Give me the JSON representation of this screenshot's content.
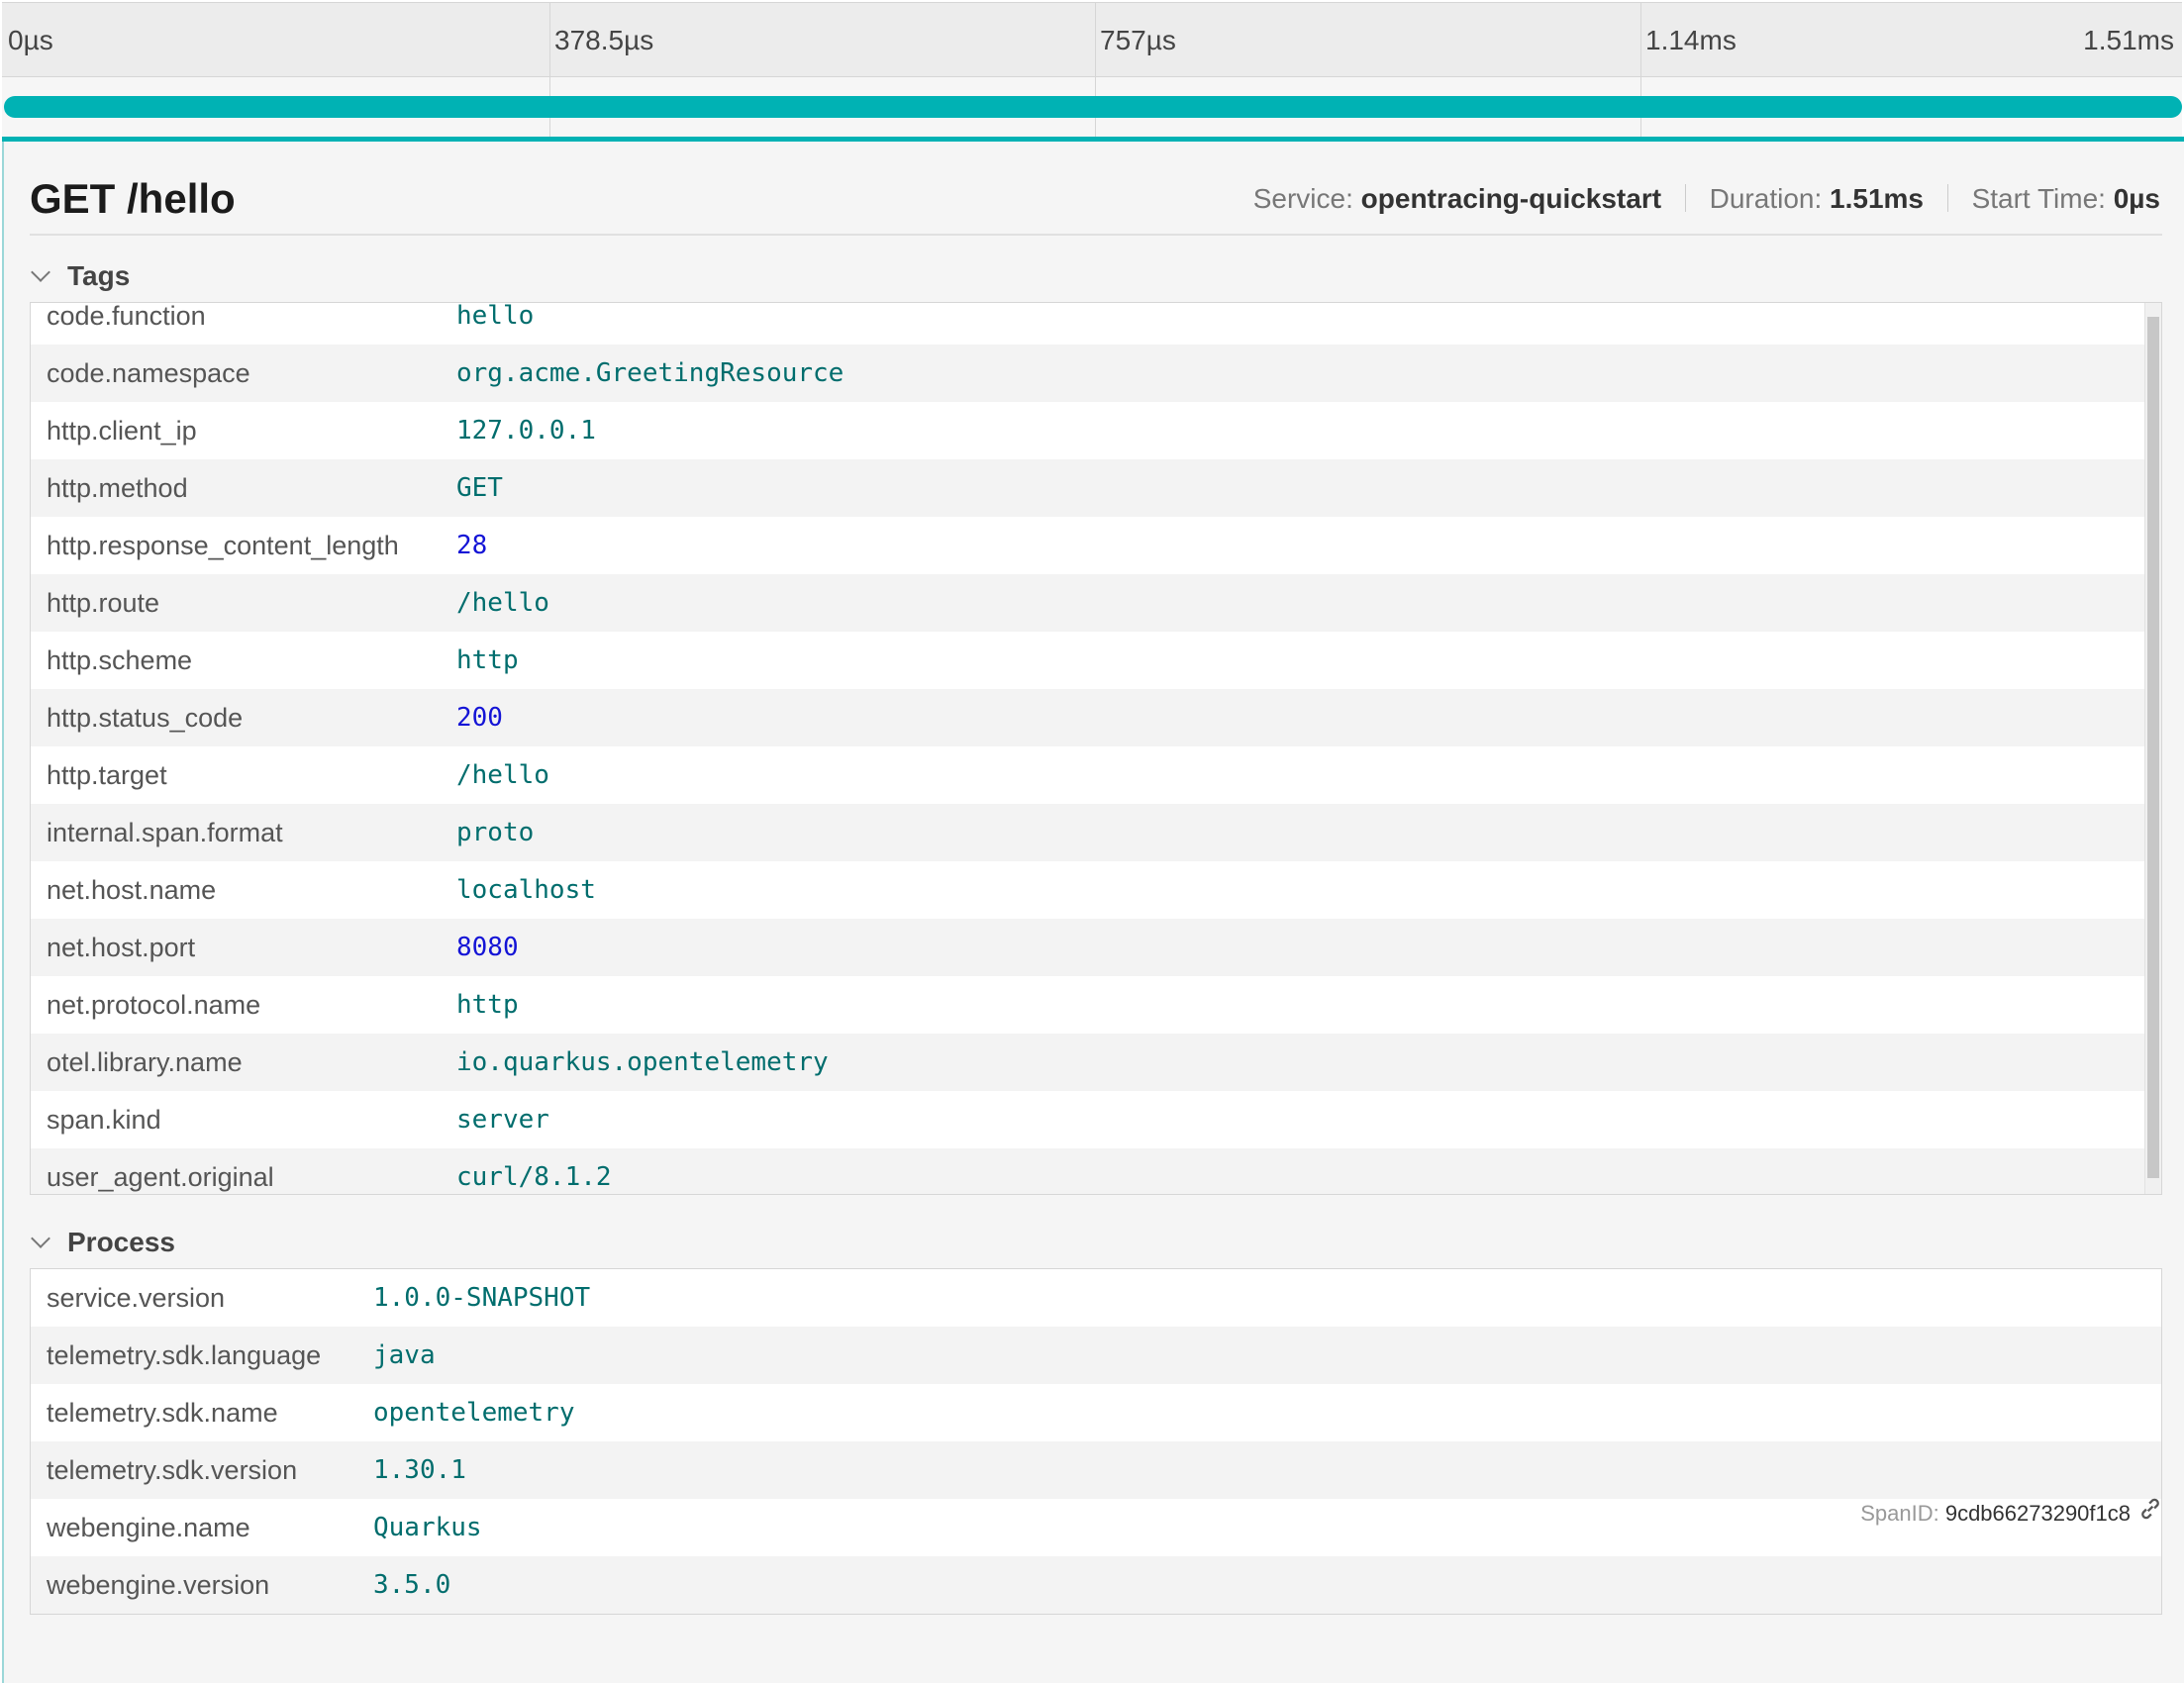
{
  "timeline": {
    "ticks": [
      "0µs",
      "378.5µs",
      "757µs",
      "1.14ms",
      "1.51ms"
    ]
  },
  "span": {
    "operation": "GET /hello",
    "service_label": "Service:",
    "service": "opentracing-quickstart",
    "duration_label": "Duration:",
    "duration": "1.51ms",
    "start_label": "Start Time:",
    "start": "0µs",
    "span_id_label": "SpanID:",
    "span_id": "9cdb66273290f1c8",
    "bar_color": "#00b2b4"
  },
  "tags": {
    "title": "Tags",
    "rows": [
      {
        "key": "code.function",
        "value": "hello",
        "type": "string"
      },
      {
        "key": "code.namespace",
        "value": "org.acme.GreetingResource",
        "type": "string"
      },
      {
        "key": "http.client_ip",
        "value": "127.0.0.1",
        "type": "string"
      },
      {
        "key": "http.method",
        "value": "GET",
        "type": "string"
      },
      {
        "key": "http.response_content_length",
        "value": "28",
        "type": "number"
      },
      {
        "key": "http.route",
        "value": "/hello",
        "type": "string"
      },
      {
        "key": "http.scheme",
        "value": "http",
        "type": "string"
      },
      {
        "key": "http.status_code",
        "value": "200",
        "type": "number"
      },
      {
        "key": "http.target",
        "value": "/hello",
        "type": "string"
      },
      {
        "key": "internal.span.format",
        "value": "proto",
        "type": "string"
      },
      {
        "key": "net.host.name",
        "value": "localhost",
        "type": "string"
      },
      {
        "key": "net.host.port",
        "value": "8080",
        "type": "number"
      },
      {
        "key": "net.protocol.name",
        "value": "http",
        "type": "string"
      },
      {
        "key": "otel.library.name",
        "value": "io.quarkus.opentelemetry",
        "type": "string"
      },
      {
        "key": "span.kind",
        "value": "server",
        "type": "string"
      },
      {
        "key": "user_agent.original",
        "value": "curl/8.1.2",
        "type": "string"
      }
    ]
  },
  "process": {
    "title": "Process",
    "rows": [
      {
        "key": "service.version",
        "value": "1.0.0-SNAPSHOT",
        "type": "string"
      },
      {
        "key": "telemetry.sdk.language",
        "value": "java",
        "type": "string"
      },
      {
        "key": "telemetry.sdk.name",
        "value": "opentelemetry",
        "type": "string"
      },
      {
        "key": "telemetry.sdk.version",
        "value": "1.30.1",
        "type": "string"
      },
      {
        "key": "webengine.name",
        "value": "Quarkus",
        "type": "string"
      },
      {
        "key": "webengine.version",
        "value": "3.5.0",
        "type": "string"
      }
    ]
  },
  "icons": {
    "section_toggle": "chevron-down-icon",
    "copy_link": "link-icon"
  }
}
